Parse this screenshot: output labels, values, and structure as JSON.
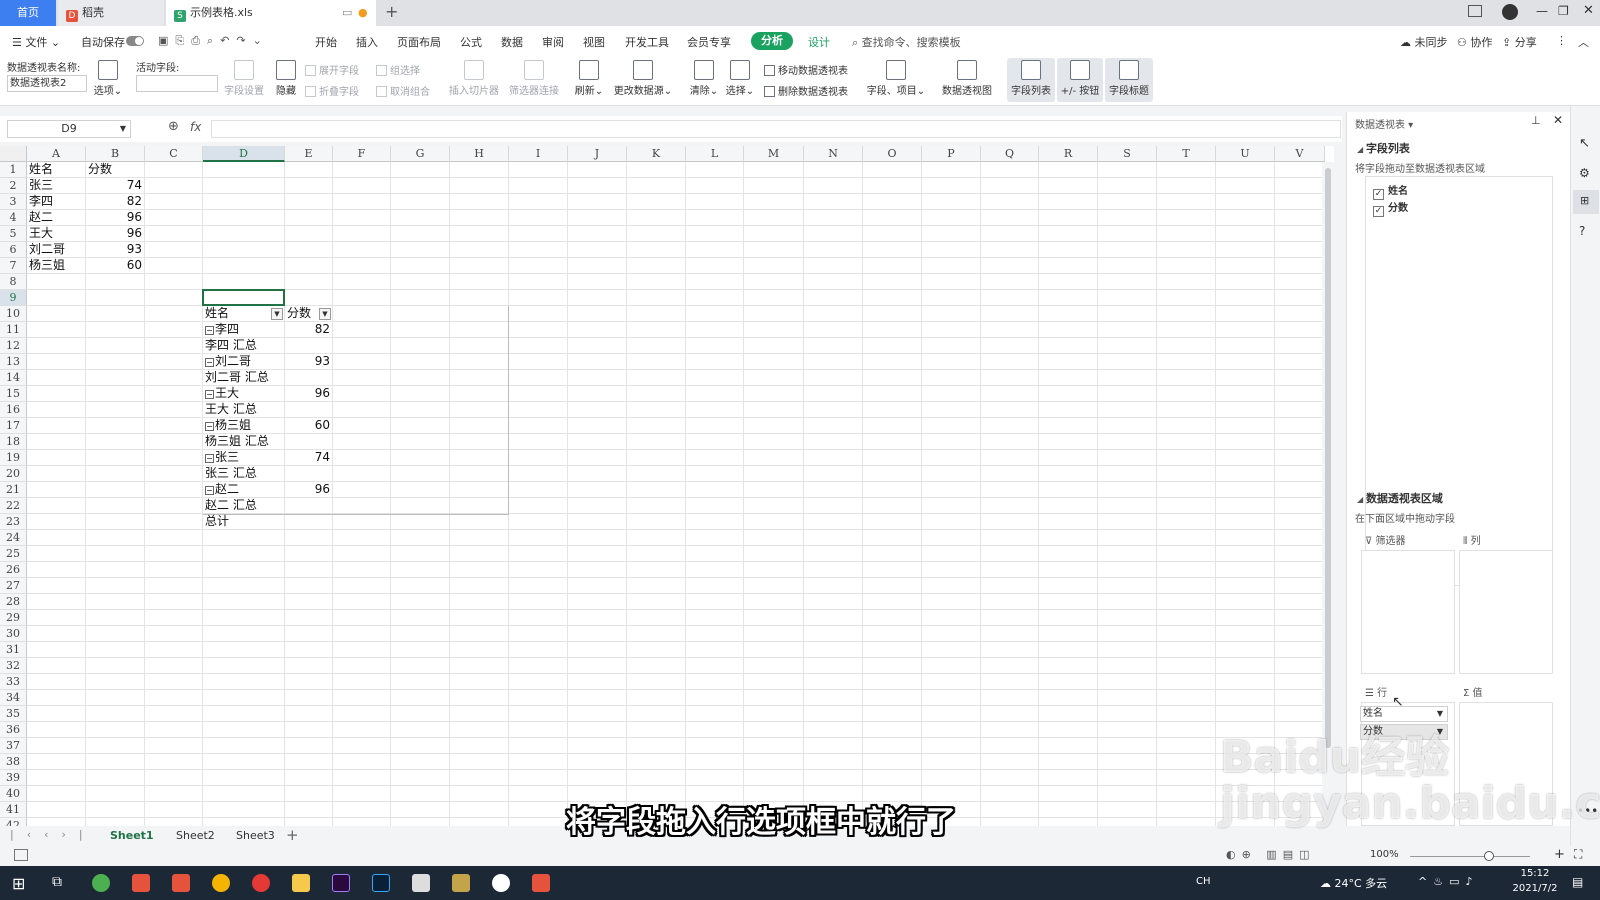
{
  "tabs": {
    "home": "首页",
    "t2": "稻壳",
    "t3": "示例表格.xls"
  },
  "menu": {
    "file": "文件",
    "autosave": "自动保存",
    "items": [
      "开始",
      "插入",
      "页面布局",
      "公式",
      "数据",
      "审阅",
      "视图",
      "开发工具",
      "会员专享",
      "分析",
      "设计"
    ],
    "search": "查找命令、搜索模板",
    "unsynced": "未同步",
    "collab": "协作",
    "share": "分享"
  },
  "ribbon": {
    "pivot_name_label": "数据透视表名称:",
    "pivot_name": "数据透视表2",
    "options": "选项",
    "active_field_label": "活动字段:",
    "field_settings": "字段设置",
    "hide": "隐藏",
    "expand_field": "展开字段",
    "collapse_field": "折叠字段",
    "group_select": "组选择",
    "ungroup": "取消组合",
    "insert_slicer": "插入切片器",
    "filter_conn": "筛选器连接",
    "refresh": "刷新",
    "change_source": "更改数据源",
    "clear": "清除",
    "select": "选择",
    "move_pivot": "移动数据透视表",
    "delete_pivot": "删除数据透视表",
    "fields_items": "字段、项目",
    "pivot_chart": "数据透视图",
    "field_list": "字段列表",
    "pm_buttons": "+/- 按钮",
    "field_headers": "字段标题"
  },
  "namebox": "D9",
  "fx": "fx",
  "columns": [
    "A",
    "B",
    "C",
    "D",
    "E",
    "F",
    "G",
    "H",
    "I",
    "J",
    "K",
    "L",
    "M",
    "N",
    "O",
    "P",
    "Q",
    "R",
    "S",
    "T",
    "U",
    "V"
  ],
  "rows": [
    "1",
    "2",
    "3",
    "4",
    "5",
    "6",
    "7",
    "8",
    "9",
    "10",
    "11",
    "12",
    "13",
    "14",
    "15",
    "16",
    "17",
    "18",
    "19",
    "20",
    "21",
    "22",
    "23",
    "24",
    "25",
    "26",
    "27",
    "28",
    "29",
    "30",
    "31",
    "32",
    "33",
    "34",
    "35",
    "36",
    "37",
    "38",
    "39",
    "40",
    "41",
    "42"
  ],
  "source": {
    "h_name": "姓名",
    "h_score": "分数",
    "names": [
      "张三",
      "李四",
      "赵二",
      "王大",
      "刘二哥",
      "杨三姐"
    ],
    "scores": [
      "74",
      "82",
      "96",
      "96",
      "93",
      "60"
    ]
  },
  "pivot": {
    "h_name": "姓名",
    "h_score": "分数",
    "rows": [
      {
        "label": "李四",
        "value": "82"
      },
      {
        "label": "李四 汇总",
        "value": ""
      },
      {
        "label": "刘二哥",
        "value": "93"
      },
      {
        "label": "刘二哥 汇总",
        "value": ""
      },
      {
        "label": "王大",
        "value": "96"
      },
      {
        "label": "王大 汇总",
        "value": ""
      },
      {
        "label": "杨三姐",
        "value": "60"
      },
      {
        "label": "杨三姐 汇总",
        "value": ""
      },
      {
        "label": "张三",
        "value": "74"
      },
      {
        "label": "张三 汇总",
        "value": ""
      },
      {
        "label": "赵二",
        "value": "96"
      },
      {
        "label": "赵二 汇总",
        "value": ""
      },
      {
        "label": "总计",
        "value": ""
      }
    ]
  },
  "sheets": [
    "Sheet1",
    "Sheet2",
    "Sheet3"
  ],
  "panel": {
    "title": "数据透视表",
    "field_list": "字段列表",
    "drag_hint": "将字段拖动至数据透视表区域",
    "fields": [
      "姓名",
      "分数"
    ],
    "areas_title": "数据透视表区域",
    "areas_hint": "在下面区域中拖动字段",
    "filter": "筛选器",
    "column": "列",
    "row": "行",
    "value": "值",
    "row_fields": [
      "姓名",
      "分数"
    ]
  },
  "subtitle": "将字段拖入行选项框中就行了",
  "status": {
    "zoom": "100%"
  },
  "taskbar": {
    "lang": "CH",
    "weather": "24°C 多云",
    "time": "15:12",
    "date": "2021/7/2"
  },
  "watermark": "Baidu经验 jingyan.baidu.com",
  "colors": {
    "accent": "#217346",
    "analysis_pill": "#1aa260",
    "home_tab": "#3d7ef0"
  }
}
